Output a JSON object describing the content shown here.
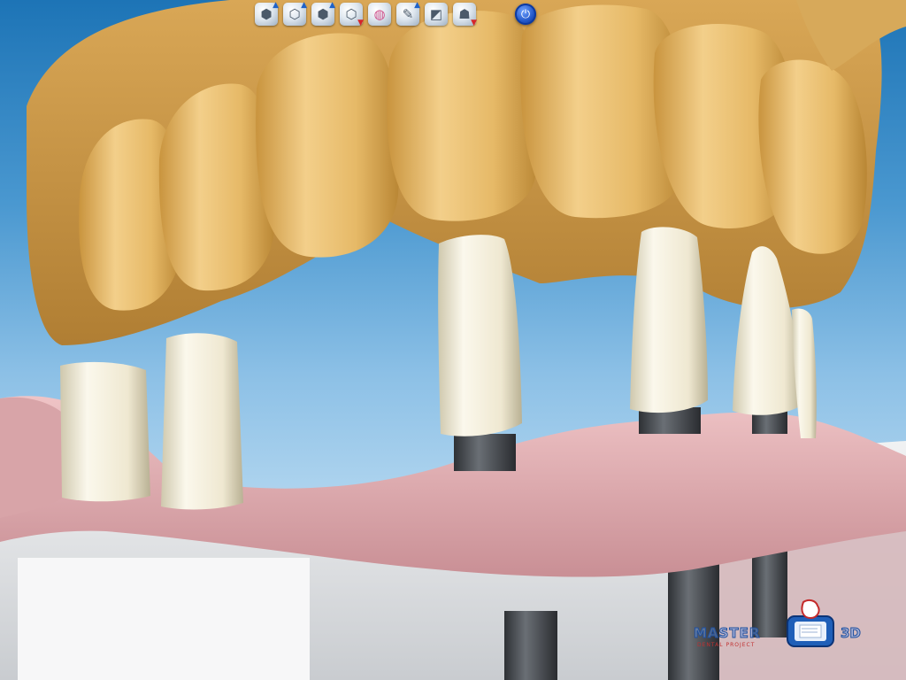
{
  "toolbar": {
    "buttons": [
      {
        "name": "model-up-icon",
        "glyph": "⬢",
        "arrow": "up"
      },
      {
        "name": "model-rotate-icon",
        "glyph": "⬡",
        "arrow": "up"
      },
      {
        "name": "model-shell-icon",
        "glyph": "⬢",
        "arrow": "up"
      },
      {
        "name": "model-down-icon",
        "glyph": "⬡",
        "arrow": "down"
      },
      {
        "name": "torus-icon",
        "glyph": "◍",
        "arrow": ""
      },
      {
        "name": "pipette-icon",
        "glyph": "✎",
        "arrow": "up"
      },
      {
        "name": "section-plane-icon",
        "glyph": "◩",
        "arrow": ""
      },
      {
        "name": "crown-down-icon",
        "glyph": "☗",
        "arrow": "down"
      }
    ],
    "power_glyph": "⏻"
  },
  "logo": {
    "brand_main": "MASTER",
    "brand_3d": "3D",
    "brand_sub": "DENTAL PROJECT"
  },
  "colors": {
    "background_top": "#1d74b6",
    "background_bottom": "#d9ecf8",
    "teeth": "#e4b86a",
    "gingiva": "#e0aeb3",
    "abutment": "#f2ecd8",
    "analog": "#4d5156",
    "base_model": "#e4e6e8",
    "accent": "#2257c8"
  }
}
